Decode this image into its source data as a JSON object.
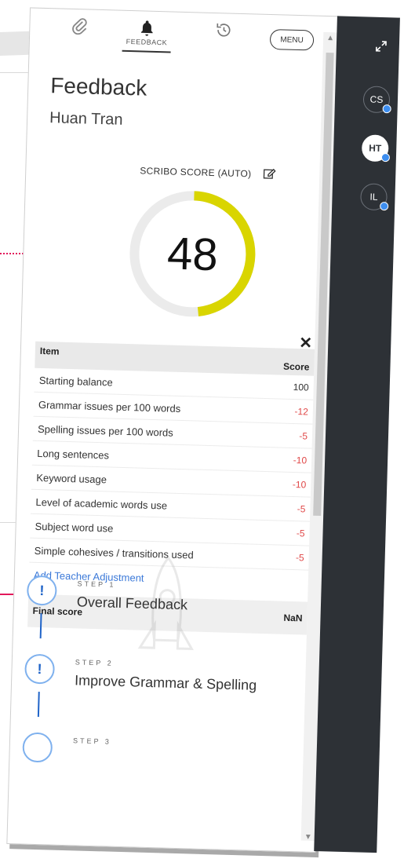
{
  "toolbar": {
    "tabs": [
      {
        "icon": "paperclip-icon",
        "label": ""
      },
      {
        "icon": "bell-icon",
        "label": "FEEDBACK"
      },
      {
        "icon": "history-icon",
        "label": ""
      }
    ],
    "menu_label": "MENU"
  },
  "header": {
    "title": "Feedback",
    "student_name": "Huan Tran",
    "score_label": "SCRIBO SCORE (AUTO)",
    "score_value": "48",
    "score_fraction": 0.48,
    "gauge_color": "#d9d500"
  },
  "table": {
    "col_item": "Item",
    "col_score": "Score",
    "rows": [
      {
        "item": "Starting balance",
        "score": "100",
        "color": "#333333"
      },
      {
        "item": "Grammar issues per 100 words",
        "score": "-12",
        "color": "#e04848"
      },
      {
        "item": "Spelling issues per 100 words",
        "score": "-5",
        "color": "#e04848"
      },
      {
        "item": "Long sentences",
        "score": "-10",
        "color": "#e04848"
      },
      {
        "item": "Keyword usage",
        "score": "-10",
        "color": "#e04848"
      },
      {
        "item": "Level of academic words use",
        "score": "-5",
        "color": "#e04848"
      },
      {
        "item": "Subject word use",
        "score": "-5",
        "color": "#e04848"
      },
      {
        "item": "Simple cohesives / transitions used",
        "score": "-5",
        "color": "#e04848"
      }
    ],
    "add_adjustment": "Add Teacher Adjustment",
    "final_label": "Final score",
    "final_value": "NaN"
  },
  "steps": [
    {
      "kicker": "STEP 1",
      "title": "Overall Feedback",
      "symbol": "!"
    },
    {
      "kicker": "STEP 2",
      "title": "Improve Grammar & Spelling",
      "symbol": "!"
    },
    {
      "kicker": "STEP 3",
      "title": "",
      "symbol": ""
    }
  ],
  "rail": {
    "avatars": [
      {
        "initials": "CS",
        "active": false
      },
      {
        "initials": "HT",
        "active": true
      },
      {
        "initials": "IL",
        "active": false
      }
    ]
  },
  "colors": {
    "accent_blue": "#3a78d8",
    "negative_red": "#e04848",
    "callout_pink": "#e2185b",
    "rail_bg": "#2d3136"
  }
}
